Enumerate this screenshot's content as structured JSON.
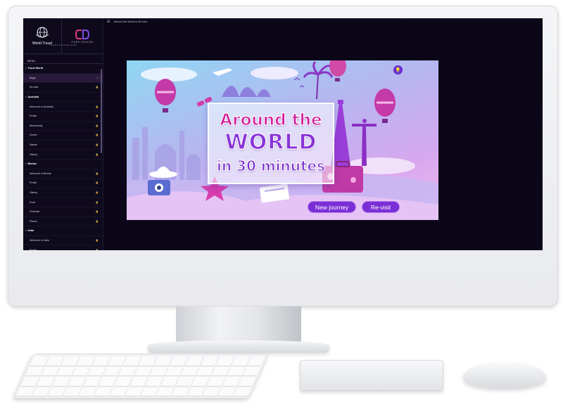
{
  "app": {
    "name": "World Travel",
    "powered_by": "Powered by CurveDesign @ 2021",
    "brand": "CURE DESIGN"
  },
  "topbar": {
    "title": "Around the World in 30 mins"
  },
  "sidebar": {
    "menu_label": "MENU",
    "items": [
      {
        "type": "section",
        "label": "Travel World"
      },
      {
        "type": "item",
        "label": "Begin",
        "icon": "check-icon",
        "active": true
      },
      {
        "type": "item",
        "label": "Re-visit",
        "icon": "lock-icon"
      },
      {
        "type": "section",
        "label": "Australia"
      },
      {
        "type": "item",
        "label": "Welcome to Australia",
        "icon": "lock-icon"
      },
      {
        "type": "item",
        "label": "Profile",
        "icon": "lock-icon"
      },
      {
        "type": "item",
        "label": "Biodiversity",
        "icon": "lock-icon"
      },
      {
        "type": "item",
        "label": "Ocean",
        "icon": "lock-icon"
      },
      {
        "type": "item",
        "label": "Nature",
        "icon": "lock-icon"
      },
      {
        "type": "item",
        "label": "History",
        "icon": "lock-icon"
      },
      {
        "type": "section",
        "label": "Bhutan"
      },
      {
        "type": "item",
        "label": "Welcome to Bhutan",
        "icon": "lock-icon"
      },
      {
        "type": "item",
        "label": "Profile",
        "icon": "lock-icon"
      },
      {
        "type": "item",
        "label": "History",
        "icon": "lock-icon"
      },
      {
        "type": "item",
        "label": "Food",
        "icon": "lock-icon"
      },
      {
        "type": "item",
        "label": "Festivals",
        "icon": "lock-icon"
      },
      {
        "type": "item",
        "label": "Places",
        "icon": "lock-icon"
      },
      {
        "type": "section",
        "label": "India"
      },
      {
        "type": "item",
        "label": "Welcome to India",
        "icon": "lock-icon"
      },
      {
        "type": "item",
        "label": "Profile",
        "icon": "lock-icon"
      }
    ]
  },
  "hero": {
    "line1": "Around the",
    "line2": "WORLD",
    "line3": "in 30 minutes",
    "new_journey_label": "New journey",
    "revisit_label": "Re-visit",
    "hint_icon": "lightbulb-icon"
  },
  "colors": {
    "accent": "#7a2fd6",
    "screen_bg": "#0b0718",
    "title_pink": "#d21d9a"
  }
}
